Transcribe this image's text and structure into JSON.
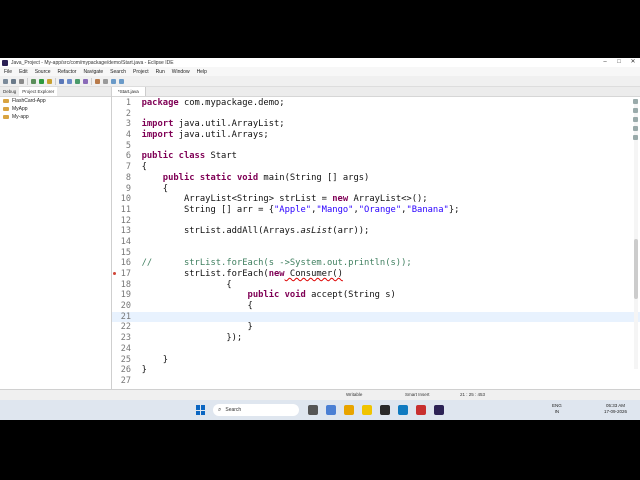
{
  "window": {
    "title": "Java_Project - My-app/src/com/mypackage/demo/Start.java - Eclipse IDE"
  },
  "menu": [
    "File",
    "Edit",
    "Source",
    "Refactor",
    "Navigate",
    "Search",
    "Project",
    "Run",
    "Window",
    "Help"
  ],
  "left_panel": {
    "tabs": [
      "Debug",
      "Project Explorer"
    ],
    "tree": [
      "FlashCard-App",
      "MyApp",
      "My-app"
    ]
  },
  "editor": {
    "tab_label": "*Start.java",
    "lines": [
      {
        "n": "1"
      },
      {
        "n": "2"
      },
      {
        "n": "3"
      },
      {
        "n": "4"
      },
      {
        "n": "5"
      },
      {
        "n": "6"
      },
      {
        "n": "7"
      },
      {
        "n": "8"
      },
      {
        "n": "9"
      },
      {
        "n": "10"
      },
      {
        "n": "11"
      },
      {
        "n": "12"
      },
      {
        "n": "13"
      },
      {
        "n": "14"
      },
      {
        "n": "15"
      },
      {
        "n": "16"
      },
      {
        "n": "17"
      },
      {
        "n": "18"
      },
      {
        "n": "19"
      },
      {
        "n": "20"
      },
      {
        "n": "21"
      },
      {
        "n": "22"
      },
      {
        "n": "23"
      },
      {
        "n": "24"
      },
      {
        "n": "25"
      },
      {
        "n": "26"
      },
      {
        "n": "27"
      }
    ],
    "tokens": {
      "package_kw": "package",
      "package_name": " com.mypackage.demo;",
      "import_kw": "import",
      "import1": " java.util.ArrayList;",
      "import2": " java.util.Arrays;",
      "public_kw": "public",
      "class_kw": "class",
      "class_name": " Start",
      "brace_open": "{",
      "brace_close": "}",
      "static_kw": "static",
      "void_kw": "void",
      "main_sig": " main(String [] args)",
      "list_decl_a": "ArrayList<String> strList = ",
      "new_kw": "new",
      "list_decl_b": " ArrayList<>();",
      "arr_decl_a": "String [] arr = {",
      "apple": "\"Apple\"",
      "mango": "\"Mango\"",
      "orange": "\"Orange\"",
      "banana": "\"Banana\"",
      "comma": ",",
      "arr_decl_end": "};",
      "addall_a": "strList.addAll(Arrays.",
      "aslist": "asList",
      "addall_b": "(arr));",
      "comment_line": "//      strList.forEach(s ->System.out.println(s));",
      "foreach_a": "strList.forEach(",
      "foreach_b": " Consumer()",
      "accept_sig": " accept(String s)",
      "close_lambda": "});"
    }
  },
  "status": {
    "writable": "Writable",
    "insert_mode": "Smart Insert",
    "position": "21 : 25 : 453"
  },
  "taskbar": {
    "search_label": "Search",
    "lang_line1": "ENG",
    "lang_line2": "IN",
    "time": "05:33 AM",
    "date": "17-09-2026"
  },
  "colors": {
    "keyword": "#7f0055",
    "string": "#2a00ff",
    "comment": "#3f7f5f",
    "current_line": "#e8f2fe",
    "error_marker": "#d04437"
  },
  "icons": [
    "java-app-icon",
    "windows-start-icon",
    "search-icon",
    "folder-icon",
    "error-marker-icon"
  ]
}
